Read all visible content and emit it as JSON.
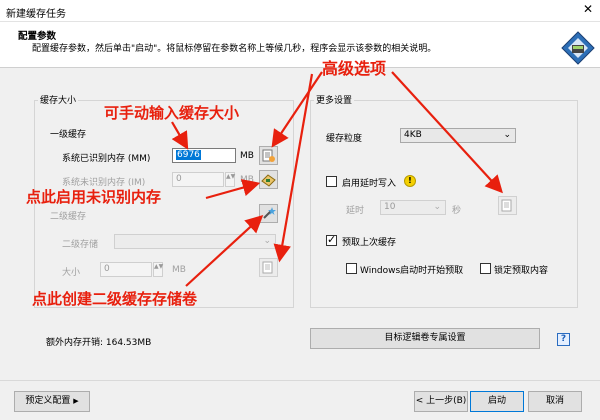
{
  "window": {
    "title": "新建缓存任务",
    "close_glyph": "✕"
  },
  "header": {
    "title": "配置参数",
    "subtitle": "配置缓存参数，然后单击\"启动\"。将鼠标停留在参数名称上等候几秒，程序会显示该参数的相关说明。"
  },
  "cache_size": {
    "group_label": "缓存大小",
    "level1": {
      "label": "一级缓存",
      "system_mem_label": "系统已识别内存 (MM)",
      "system_mem_value": "6976",
      "system_mem_unit": "MB",
      "unrecognized_mem_label": "系统未识别内存 (IM)",
      "unrecognized_mem_value": "0",
      "unrecognized_mem_unit": "MB"
    },
    "level2": {
      "label": "二级缓存",
      "storage_label": "二级存储",
      "storage_value": "",
      "size_label": "大小",
      "size_value": "0",
      "size_unit": "MB"
    }
  },
  "more_settings": {
    "group_label": "更多设置",
    "granularity_label": "缓存粒度",
    "granularity_value": "4KB",
    "delayed_write_label": "启用延时写入",
    "delayed_write_checked": false,
    "delay_label": "延时",
    "delay_value": "10",
    "delay_unit": "秒",
    "prefetch_label": "预取上次缓存",
    "prefetch_checked": true,
    "prefetch_on_start_label": "Windows启动时开始预取",
    "prefetch_on_start_checked": false,
    "lock_prefetch_label": "锁定预取内容",
    "lock_prefetch_checked": false
  },
  "extra_memory": {
    "label": "额外内存开销: 164.53MB"
  },
  "target_volume_button": "目标逻辑卷专属设置",
  "help_glyph": "?",
  "footer": {
    "preset_button": "预定义配置",
    "back_button": "< 上一步(B)",
    "start_button": "启动",
    "cancel_button": "取消"
  },
  "annotations": {
    "manual_input": "可手动输入缓存大小",
    "advanced_options": "高级选项",
    "enable_unrecognized": "点此启用未识别内存",
    "create_l2_volume": "点此创建二级缓存存储卷"
  },
  "colors": {
    "annotation_red": "#e8200e",
    "accent_blue": "#0078d7",
    "selection_blue": "#0078d7"
  }
}
